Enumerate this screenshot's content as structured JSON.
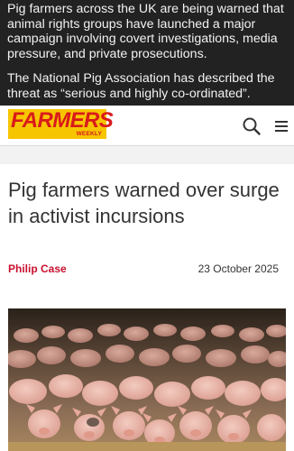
{
  "overlay": {
    "paragraph1": "Pig farmers across the UK are being warned that animal rights groups have launched a major campaign involving covert investigations, media pressure, and private prosecutions.",
    "paragraph2": "The National Pig Association has described the threat as “serious and highly co-ordinated”."
  },
  "header": {
    "logo_text": "FARMERS",
    "logo_subtext": "WEEKLY",
    "search_icon": "search-icon",
    "menu_icon": "hamburger-menu-icon"
  },
  "article": {
    "title": "Pig farmers warned over surge in activist incursions",
    "author": "Philip Case",
    "date": "23 October 2025",
    "image_subject": "piglets-in-barn-photo"
  },
  "colors": {
    "logo_bg": "#f7c500",
    "logo_text": "#d91a1a",
    "author": "#c8102e",
    "overlay_bg": "#222222"
  }
}
